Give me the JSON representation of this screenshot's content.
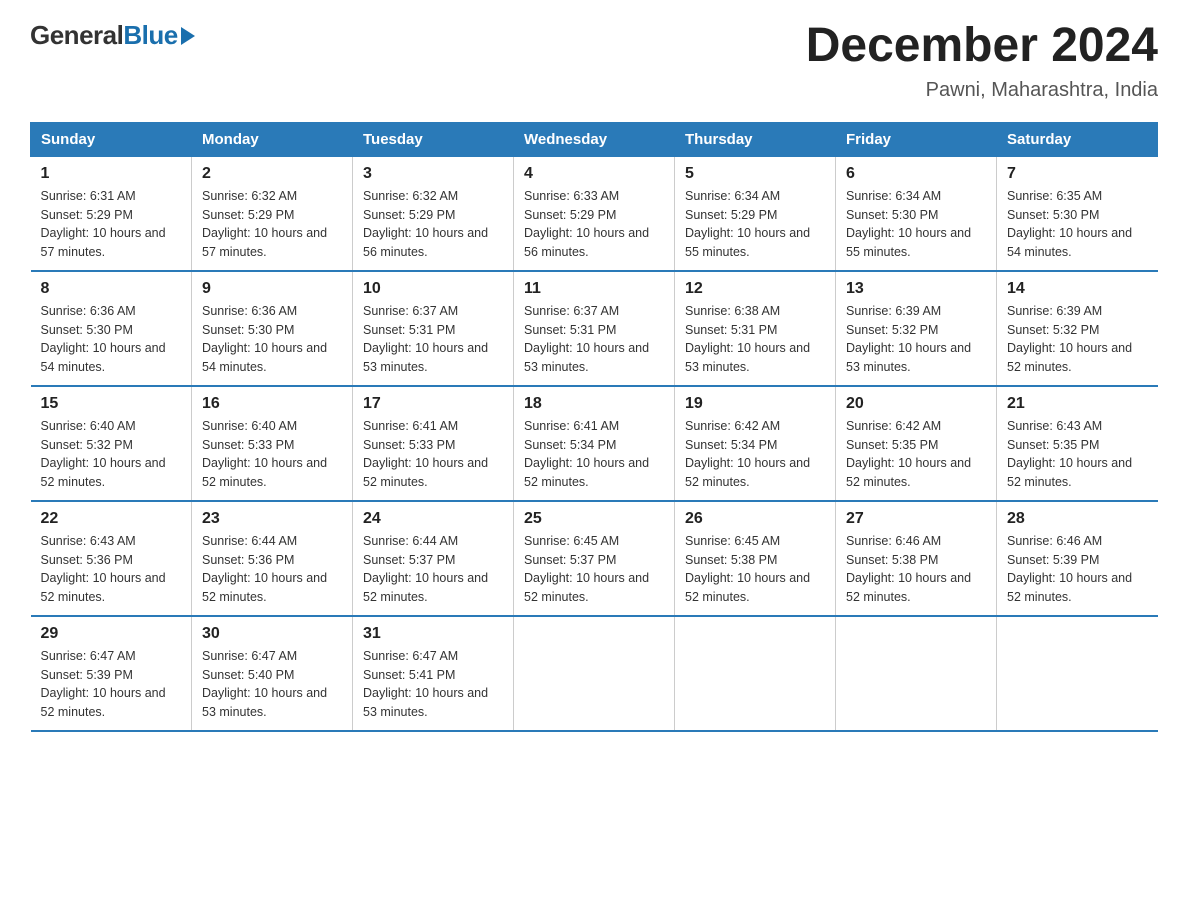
{
  "header": {
    "logo_general": "General",
    "logo_blue": "Blue",
    "month_title": "December 2024",
    "location": "Pawni, Maharashtra, India"
  },
  "columns": [
    "Sunday",
    "Monday",
    "Tuesday",
    "Wednesday",
    "Thursday",
    "Friday",
    "Saturday"
  ],
  "weeks": [
    [
      {
        "day": "1",
        "sunrise": "6:31 AM",
        "sunset": "5:29 PM",
        "daylight": "10 hours and 57 minutes."
      },
      {
        "day": "2",
        "sunrise": "6:32 AM",
        "sunset": "5:29 PM",
        "daylight": "10 hours and 57 minutes."
      },
      {
        "day": "3",
        "sunrise": "6:32 AM",
        "sunset": "5:29 PM",
        "daylight": "10 hours and 56 minutes."
      },
      {
        "day": "4",
        "sunrise": "6:33 AM",
        "sunset": "5:29 PM",
        "daylight": "10 hours and 56 minutes."
      },
      {
        "day": "5",
        "sunrise": "6:34 AM",
        "sunset": "5:29 PM",
        "daylight": "10 hours and 55 minutes."
      },
      {
        "day": "6",
        "sunrise": "6:34 AM",
        "sunset": "5:30 PM",
        "daylight": "10 hours and 55 minutes."
      },
      {
        "day": "7",
        "sunrise": "6:35 AM",
        "sunset": "5:30 PM",
        "daylight": "10 hours and 54 minutes."
      }
    ],
    [
      {
        "day": "8",
        "sunrise": "6:36 AM",
        "sunset": "5:30 PM",
        "daylight": "10 hours and 54 minutes."
      },
      {
        "day": "9",
        "sunrise": "6:36 AM",
        "sunset": "5:30 PM",
        "daylight": "10 hours and 54 minutes."
      },
      {
        "day": "10",
        "sunrise": "6:37 AM",
        "sunset": "5:31 PM",
        "daylight": "10 hours and 53 minutes."
      },
      {
        "day": "11",
        "sunrise": "6:37 AM",
        "sunset": "5:31 PM",
        "daylight": "10 hours and 53 minutes."
      },
      {
        "day": "12",
        "sunrise": "6:38 AM",
        "sunset": "5:31 PM",
        "daylight": "10 hours and 53 minutes."
      },
      {
        "day": "13",
        "sunrise": "6:39 AM",
        "sunset": "5:32 PM",
        "daylight": "10 hours and 53 minutes."
      },
      {
        "day": "14",
        "sunrise": "6:39 AM",
        "sunset": "5:32 PM",
        "daylight": "10 hours and 52 minutes."
      }
    ],
    [
      {
        "day": "15",
        "sunrise": "6:40 AM",
        "sunset": "5:32 PM",
        "daylight": "10 hours and 52 minutes."
      },
      {
        "day": "16",
        "sunrise": "6:40 AM",
        "sunset": "5:33 PM",
        "daylight": "10 hours and 52 minutes."
      },
      {
        "day": "17",
        "sunrise": "6:41 AM",
        "sunset": "5:33 PM",
        "daylight": "10 hours and 52 minutes."
      },
      {
        "day": "18",
        "sunrise": "6:41 AM",
        "sunset": "5:34 PM",
        "daylight": "10 hours and 52 minutes."
      },
      {
        "day": "19",
        "sunrise": "6:42 AM",
        "sunset": "5:34 PM",
        "daylight": "10 hours and 52 minutes."
      },
      {
        "day": "20",
        "sunrise": "6:42 AM",
        "sunset": "5:35 PM",
        "daylight": "10 hours and 52 minutes."
      },
      {
        "day": "21",
        "sunrise": "6:43 AM",
        "sunset": "5:35 PM",
        "daylight": "10 hours and 52 minutes."
      }
    ],
    [
      {
        "day": "22",
        "sunrise": "6:43 AM",
        "sunset": "5:36 PM",
        "daylight": "10 hours and 52 minutes."
      },
      {
        "day": "23",
        "sunrise": "6:44 AM",
        "sunset": "5:36 PM",
        "daylight": "10 hours and 52 minutes."
      },
      {
        "day": "24",
        "sunrise": "6:44 AM",
        "sunset": "5:37 PM",
        "daylight": "10 hours and 52 minutes."
      },
      {
        "day": "25",
        "sunrise": "6:45 AM",
        "sunset": "5:37 PM",
        "daylight": "10 hours and 52 minutes."
      },
      {
        "day": "26",
        "sunrise": "6:45 AM",
        "sunset": "5:38 PM",
        "daylight": "10 hours and 52 minutes."
      },
      {
        "day": "27",
        "sunrise": "6:46 AM",
        "sunset": "5:38 PM",
        "daylight": "10 hours and 52 minutes."
      },
      {
        "day": "28",
        "sunrise": "6:46 AM",
        "sunset": "5:39 PM",
        "daylight": "10 hours and 52 minutes."
      }
    ],
    [
      {
        "day": "29",
        "sunrise": "6:47 AM",
        "sunset": "5:39 PM",
        "daylight": "10 hours and 52 minutes."
      },
      {
        "day": "30",
        "sunrise": "6:47 AM",
        "sunset": "5:40 PM",
        "daylight": "10 hours and 53 minutes."
      },
      {
        "day": "31",
        "sunrise": "6:47 AM",
        "sunset": "5:41 PM",
        "daylight": "10 hours and 53 minutes."
      },
      null,
      null,
      null,
      null
    ]
  ]
}
